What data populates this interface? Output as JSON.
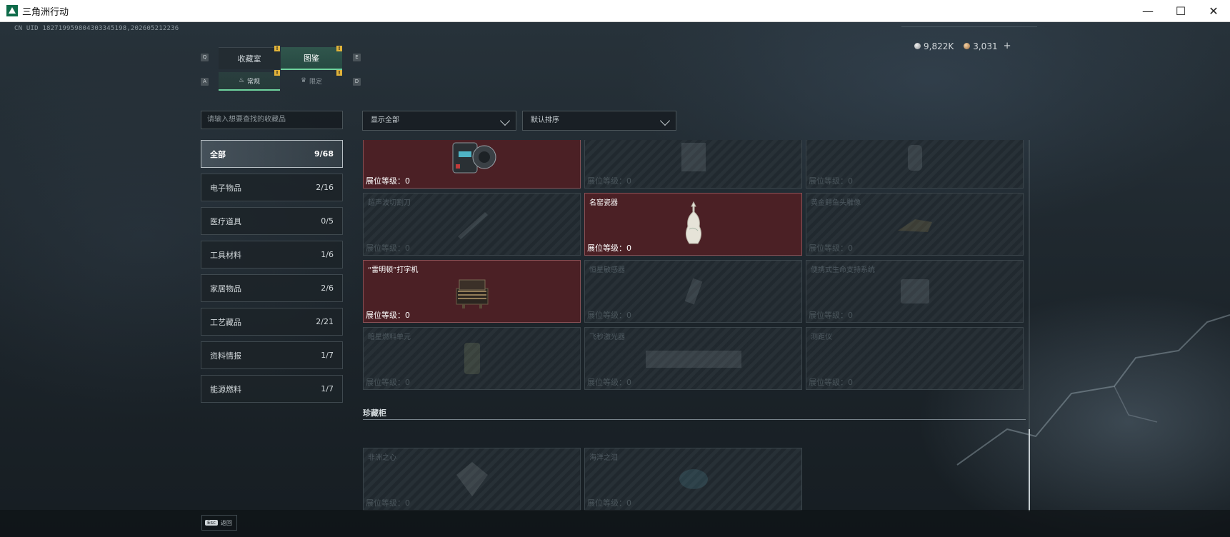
{
  "window": {
    "title": "三角洲行动",
    "controls": {
      "minimize": "—",
      "maximize": "☐",
      "close": "✕"
    }
  },
  "uid": "CN UID 182719959804303345198,202605212236",
  "currency": {
    "silver": "9,822K",
    "bronze": "3,031",
    "add": "+"
  },
  "tabs": {
    "key_left": "Q",
    "key_right": "E",
    "items": [
      {
        "label": "收藏室",
        "active": false,
        "badge": "!"
      },
      {
        "label": "图鉴",
        "active": true,
        "badge": "!"
      }
    ]
  },
  "subtabs": {
    "key_left": "A",
    "key_right": "D",
    "items": [
      {
        "label": "常规",
        "active": true,
        "badge": "!"
      },
      {
        "label": "限定",
        "active": false,
        "badge": "!"
      }
    ]
  },
  "search": {
    "placeholder": "请输入想要查找的收藏品"
  },
  "filters": {
    "show": "显示全部",
    "sort": "默认排序"
  },
  "categories": [
    {
      "label": "全部",
      "count": "9/68",
      "active": true
    },
    {
      "label": "电子物品",
      "count": "2/16",
      "active": false
    },
    {
      "label": "医疗道具",
      "count": "0/5",
      "active": false
    },
    {
      "label": "工具材料",
      "count": "1/6",
      "active": false
    },
    {
      "label": "家居物品",
      "count": "2/6",
      "active": false
    },
    {
      "label": "工艺藏品",
      "count": "2/21",
      "active": false
    },
    {
      "label": "资料情报",
      "count": "1/7",
      "active": false
    },
    {
      "label": "能源燃料",
      "count": "1/7",
      "active": false
    }
  ],
  "cards": [
    {
      "name": "",
      "level": "展位等级：0",
      "owned": true
    },
    {
      "name": "",
      "level": "展位等级：0",
      "owned": false
    },
    {
      "name": "",
      "level": "展位等级：0",
      "owned": false
    },
    {
      "name": "超声波切割刀",
      "level": "展位等级：0",
      "owned": false
    },
    {
      "name": "名窑瓷器",
      "level": "展位等级：0",
      "owned": true
    },
    {
      "name": "黄金鳄鱼头雕像",
      "level": "展位等级：0",
      "owned": false
    },
    {
      "name": "“雷明顿”打字机",
      "level": "展位等级：0",
      "owned": true
    },
    {
      "name": "恒星敏感器",
      "level": "展位等级：0",
      "owned": false
    },
    {
      "name": "便携式生命支持系统",
      "level": "展位等级：0",
      "owned": false
    },
    {
      "name": "暗星燃料单元",
      "level": "展位等级：0",
      "owned": false
    },
    {
      "name": "飞秒激光器",
      "level": "展位等级：0",
      "owned": false
    },
    {
      "name": "测距仪",
      "level": "展位等级：0",
      "owned": false
    }
  ],
  "section": {
    "title": "珍藏柜"
  },
  "treasure_cards": [
    {
      "name": "非洲之心",
      "level": "展位等级：0",
      "owned": false
    },
    {
      "name": "海洋之泪",
      "level": "展位等级：0",
      "owned": false
    }
  ],
  "footer": {
    "esc_key": "Esc",
    "esc_label": "返回"
  }
}
